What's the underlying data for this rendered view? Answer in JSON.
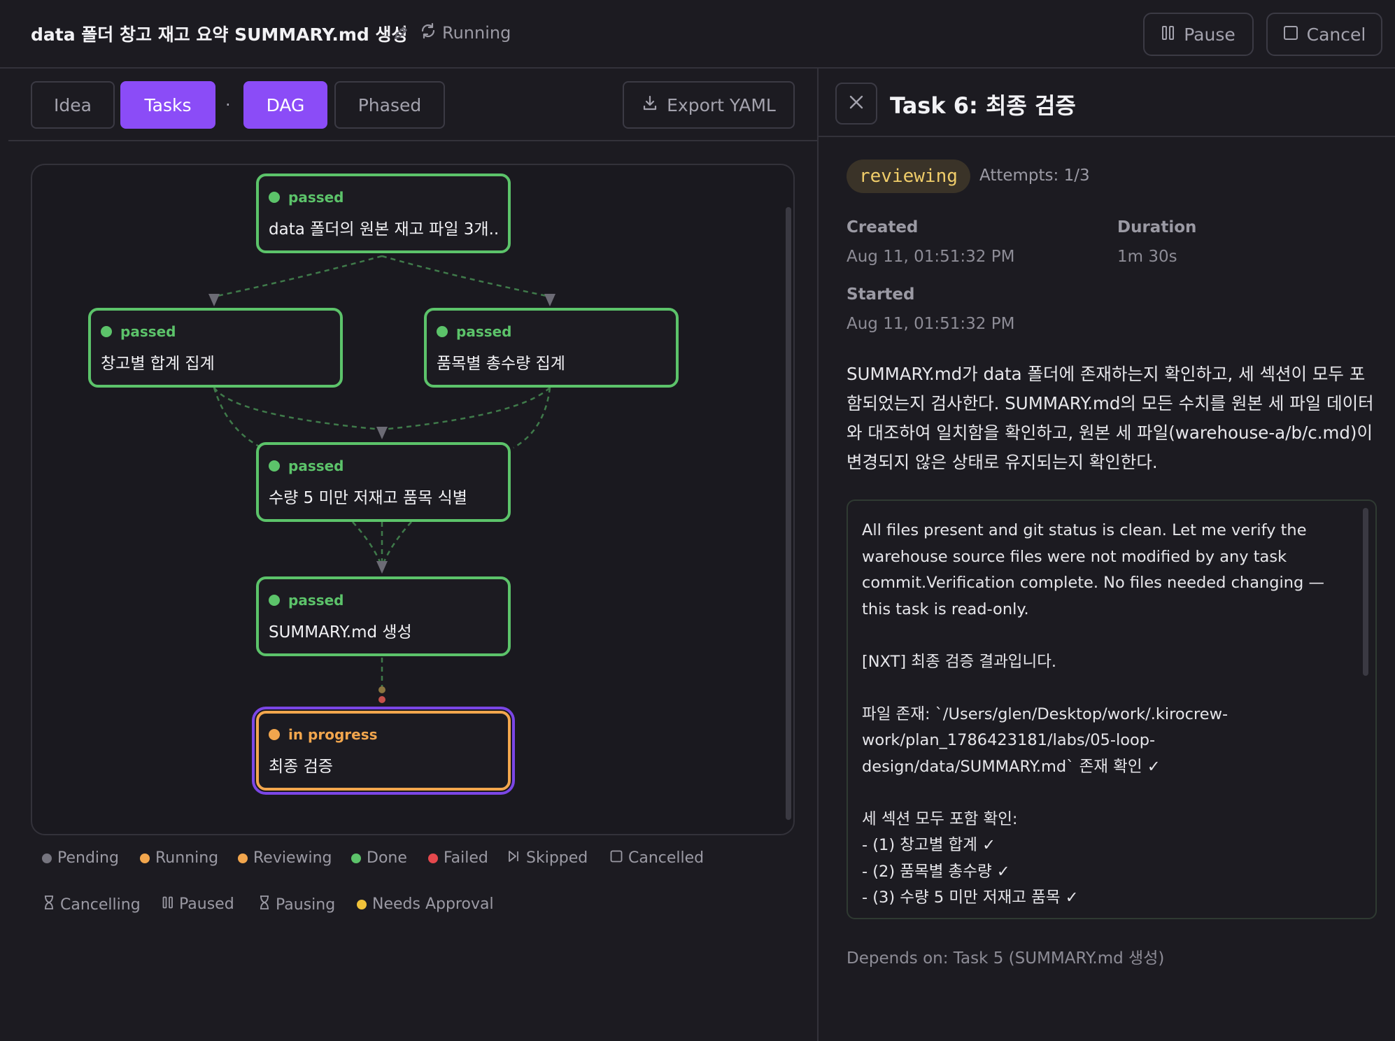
{
  "header": {
    "title": "data 폴더 창고 재고 요약 SUMMARY.md 생성",
    "status": "Running",
    "pause_label": "Pause",
    "cancel_label": "Cancel"
  },
  "toolbar": {
    "tabs": [
      "Idea",
      "Tasks",
      "DAG",
      "Phased"
    ],
    "separator": "·",
    "export_label": "Export YAML"
  },
  "dag": {
    "nodes": [
      {
        "status": "passed",
        "label": "data 폴더의 원본 재고 파일 3개..."
      },
      {
        "status": "passed",
        "label": "창고별 합계 집계"
      },
      {
        "status": "passed",
        "label": "품목별 총수량 집계"
      },
      {
        "status": "passed",
        "label": "수량 5 미만 저재고 품목 식별"
      },
      {
        "status": "passed",
        "label": "SUMMARY.md 생성"
      },
      {
        "status": "in progress",
        "label": "최종 검증"
      }
    ]
  },
  "legend": {
    "items": [
      {
        "label": "Pending",
        "color": "#76757f"
      },
      {
        "label": "Running",
        "color": "#f2a64d"
      },
      {
        "label": "Reviewing",
        "color": "#f2a64d"
      },
      {
        "label": "Done",
        "color": "#5cc36a"
      },
      {
        "label": "Failed",
        "color": "#e5484d"
      },
      {
        "label": "Skipped",
        "icon": "skip-icon"
      },
      {
        "label": "Cancelled",
        "icon": "square-icon"
      },
      {
        "label": "Cancelling",
        "icon": "hourglass-icon"
      },
      {
        "label": "Paused",
        "icon": "pause-icon"
      },
      {
        "label": "Pausing",
        "icon": "hourglass-icon"
      },
      {
        "label": "Needs Approval",
        "color": "#f0c23a"
      }
    ]
  },
  "detail": {
    "title": "Task 6: 최종 검증",
    "badge": "reviewing",
    "attempts": "Attempts: 1/3",
    "created_label": "Created",
    "created_value": "Aug 11, 01:51:32 PM",
    "duration_label": "Duration",
    "duration_value": "1m 30s",
    "started_label": "Started",
    "started_value": "Aug 11, 01:51:32 PM",
    "description": "SUMMARY.md가 data 폴더에 존재하는지 확인하고, 세 섹션이 모두 포함되었는지 검사한다. SUMMARY.md의 모든 수치를 원본 세 파일 데이터와 대조하여 일치함을 확인하고, 원본 세 파일(warehouse-a/b/c.md)이 변경되지 않은 상태로 유지되는지 확인한다.",
    "log": "All files present and git status is clean. Let me verify the\nwarehouse source files were not modified by any task\ncommit.Verification complete. No files needed changing —\nthis task is read-only.\n\n[NXT] 최종 검증 결과입니다.\n\n파일 존재: `/Users/glen/Desktop/work/.kirocrew-\nwork/plan_1786423181/labs/05-loop-\ndesign/data/SUMMARY.md` 존재 확인 ✓\n\n세 섹션 모두 포함 확인:\n- (1) 창고별 합계 ✓\n- (2) 품목별 총수량 ✓\n- (3) 수량 5 미만 저재고 품목 ✓",
    "depends_on": "Depends on: Task 5 (SUMMARY.md 생성)"
  },
  "colors": {
    "accent": "#8b4cf7",
    "passed": "#5cc36a",
    "in_progress": "#f2a64d",
    "selected_outline": "#7b46e6"
  }
}
